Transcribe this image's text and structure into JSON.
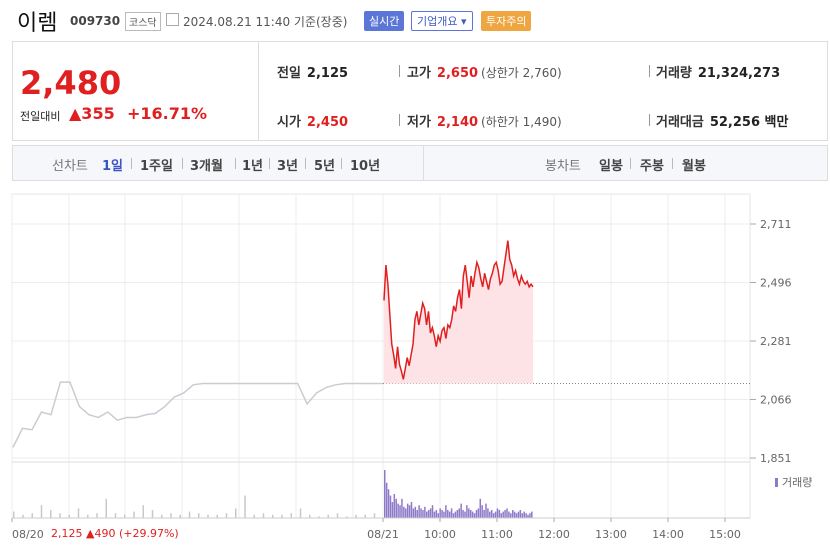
{
  "header": {
    "name": "이렘",
    "code": "009730",
    "market": "코스닥",
    "datetime": "2024.08.21 11:40 기준(장중)",
    "live_label": "실시간",
    "overview_label": "기업개요",
    "warning_label": "투자주의"
  },
  "quote": {
    "price": "2,480",
    "diff_label": "전일대비",
    "diff_value": "▲355",
    "diff_pct": "+16.71%",
    "prev_close_label": "전일",
    "prev_close": "2,125",
    "open_label": "시가",
    "open": "2,450",
    "high_label": "고가",
    "high": "2,650",
    "upper_limit": "(상한가 2,760)",
    "low_label": "저가",
    "low": "2,140",
    "lower_limit": "(하한가 1,490)",
    "volume_label": "거래량",
    "volume": "21,324,273",
    "amount_label": "거래대금",
    "amount": "52,256 백만"
  },
  "tabs": {
    "line_label": "선차트",
    "line_items": [
      "1일",
      "1주일",
      "3개월",
      "1년",
      "3년",
      "5년",
      "10년"
    ],
    "active": "1일",
    "candle_label": "봉차트",
    "candle_items": [
      "일봉",
      "주봉",
      "월봉"
    ]
  },
  "colors": {
    "up": "#e02020",
    "accent": "#3853c5",
    "area": "#fde3e6",
    "prev_line": "#c8cdd3",
    "volume_today": "#8f79c9",
    "volume_prev": "#c5c8cc"
  },
  "chart_data": {
    "type": "line",
    "y_ticks": [
      "2,711",
      "2,496",
      "2,281",
      "2,066",
      "1,851"
    ],
    "ylim": [
      1851,
      2711
    ],
    "x_labels": [
      "08/20",
      "08/21",
      "10:00",
      "11:00",
      "12:00",
      "13:00",
      "14:00",
      "15:00"
    ],
    "reference_price": 2125,
    "prev_day": {
      "date": "08/20",
      "close_text": "2,125",
      "change_text": "▲490",
      "pct_text": "(+29.97%)",
      "values": [
        1890,
        1960,
        1955,
        2020,
        2010,
        2130,
        2130,
        2040,
        2010,
        2000,
        2020,
        1990,
        2000,
        2000,
        2010,
        2015,
        2040,
        2075,
        2090,
        2120,
        2125,
        2125,
        2125,
        2125,
        2125,
        2125,
        2125,
        2125,
        2125,
        2125,
        2125,
        2050,
        2090,
        2110,
        2120,
        2125,
        2125,
        2125,
        2125,
        2125
      ]
    },
    "today": {
      "date": "08/21",
      "values": [
        2430,
        2560,
        2490,
        2380,
        2270,
        2230,
        2180,
        2260,
        2195,
        2170,
        2140,
        2180,
        2220,
        2190,
        2230,
        2270,
        2360,
        2390,
        2340,
        2380,
        2420,
        2400,
        2340,
        2390,
        2310,
        2330,
        2300,
        2260,
        2300,
        2280,
        2320,
        2330,
        2290,
        2340,
        2330,
        2360,
        2410,
        2390,
        2440,
        2470,
        2400,
        2520,
        2560,
        2500,
        2440,
        2520,
        2480,
        2530,
        2570,
        2550,
        2510,
        2480,
        2530,
        2500,
        2470,
        2510,
        2530,
        2560,
        2570,
        2540,
        2490,
        2500,
        2550,
        2600,
        2650,
        2580,
        2560,
        2520,
        2540,
        2510,
        2490,
        2520,
        2500,
        2490,
        2500,
        2480,
        2490,
        2480
      ]
    },
    "volume_label": "거래량",
    "volume": {
      "prev_day": [
        4,
        2,
        3,
        8,
        5,
        3,
        2,
        6,
        2,
        3,
        12,
        3,
        2,
        4,
        8,
        5,
        2,
        3,
        2,
        4,
        3,
        2,
        2,
        3,
        6,
        14,
        2,
        3,
        2,
        2,
        3,
        6,
        2,
        1,
        2,
        3,
        1,
        2,
        2,
        3
      ],
      "today": [
        30,
        22,
        18,
        14,
        10,
        15,
        12,
        9,
        8,
        12,
        7,
        6,
        9,
        8,
        10,
        6,
        7,
        5,
        8,
        6,
        5,
        7,
        4,
        5,
        6,
        8,
        4,
        5,
        3,
        6,
        5,
        4,
        8,
        5,
        4,
        6,
        3,
        4,
        5,
        6,
        9,
        5,
        4,
        8,
        6,
        5,
        4,
        3,
        5,
        6,
        12,
        8,
        5,
        9,
        6,
        4,
        5,
        3,
        4,
        6,
        5,
        3,
        4,
        5,
        6,
        4,
        3,
        5,
        4,
        3,
        4,
        5,
        3,
        4,
        3,
        2,
        3,
        4
      ]
    }
  }
}
